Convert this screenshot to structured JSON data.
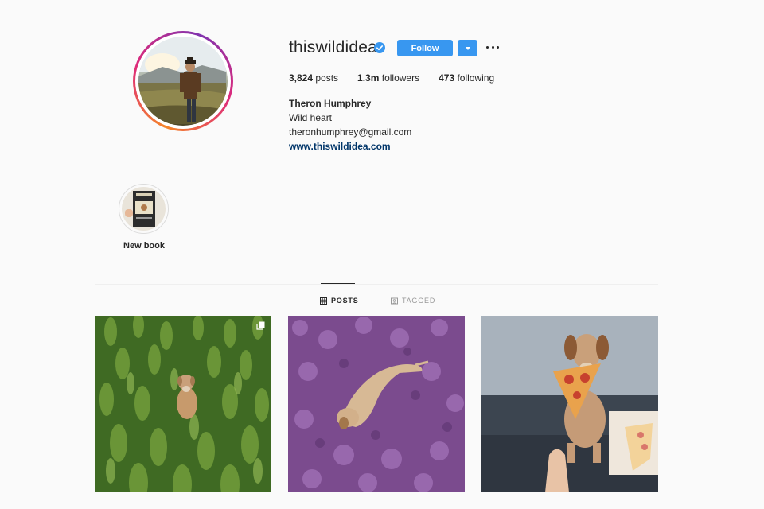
{
  "profile": {
    "username": "thiswildidea",
    "verified": true,
    "follow_label": "Follow",
    "stats": {
      "posts_count": "3,824",
      "posts_label": " posts",
      "followers_count": "1.3m",
      "followers_label": " followers",
      "following_count": "473",
      "following_label": " following"
    },
    "full_name": "Theron Humphrey",
    "bio": [
      "Wild heart",
      "theronhumphrey@gmail.com"
    ],
    "website": "www.thiswildidea.com"
  },
  "highlights": [
    {
      "label": "New book"
    }
  ],
  "tabs": [
    {
      "label": "POSTS",
      "active": true,
      "icon": "grid-icon"
    },
    {
      "label": "TAGGED",
      "active": false,
      "icon": "tag-icon"
    }
  ],
  "posts": [
    {
      "subject": "dog-in-green-plants",
      "multi": true
    },
    {
      "subject": "dog-in-purple-flowers",
      "multi": false
    },
    {
      "subject": "dog-with-pizza",
      "multi": false
    }
  ],
  "colors": {
    "follow_button": "#3897f0",
    "website_link": "#003569",
    "background": "#fafafa"
  }
}
